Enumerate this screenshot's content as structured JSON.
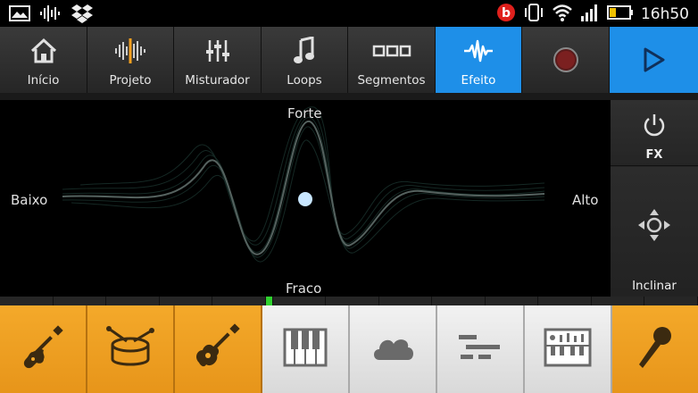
{
  "status_bar": {
    "time": "16h50",
    "left_icons": [
      "gallery-icon",
      "audio-wave-icon",
      "dropbox-icon"
    ],
    "right_icons": [
      "beats-icon",
      "vibrate-icon",
      "wifi-icon",
      "signal-icon",
      "battery-icon"
    ]
  },
  "toolbar": {
    "items": [
      {
        "label": "Início",
        "icon": "home-icon"
      },
      {
        "label": "Projeto",
        "icon": "waveform-icon"
      },
      {
        "label": "Misturador",
        "icon": "mixer-icon"
      },
      {
        "label": "Loops",
        "icon": "music-note-icon"
      },
      {
        "label": "Segmentos",
        "icon": "segments-icon"
      },
      {
        "label": "Efeito",
        "icon": "effect-wave-icon",
        "active": true
      }
    ],
    "accent_color": "#1e8fe8"
  },
  "effect_pad": {
    "label_top": "Forte",
    "label_bottom": "Fraco",
    "label_left": "Baixo",
    "label_right": "Alto"
  },
  "side_panel": {
    "fx_label": "FX",
    "tilt_label": "Inclinar"
  },
  "meter": {
    "segments": 14,
    "active_index": 5,
    "active_color": "#2fd12f"
  },
  "instruments": [
    {
      "icon": "electric-guitar-icon",
      "style": "orange"
    },
    {
      "icon": "drum-icon",
      "style": "orange"
    },
    {
      "icon": "acoustic-guitar-icon",
      "style": "orange"
    },
    {
      "icon": "piano-keys-icon",
      "style": "white"
    },
    {
      "icon": "cloud-pad-icon",
      "style": "white"
    },
    {
      "icon": "sequencer-bars-icon",
      "style": "white"
    },
    {
      "icon": "synth-keyboard-icon",
      "style": "white"
    },
    {
      "icon": "microphone-icon",
      "style": "orange"
    }
  ]
}
